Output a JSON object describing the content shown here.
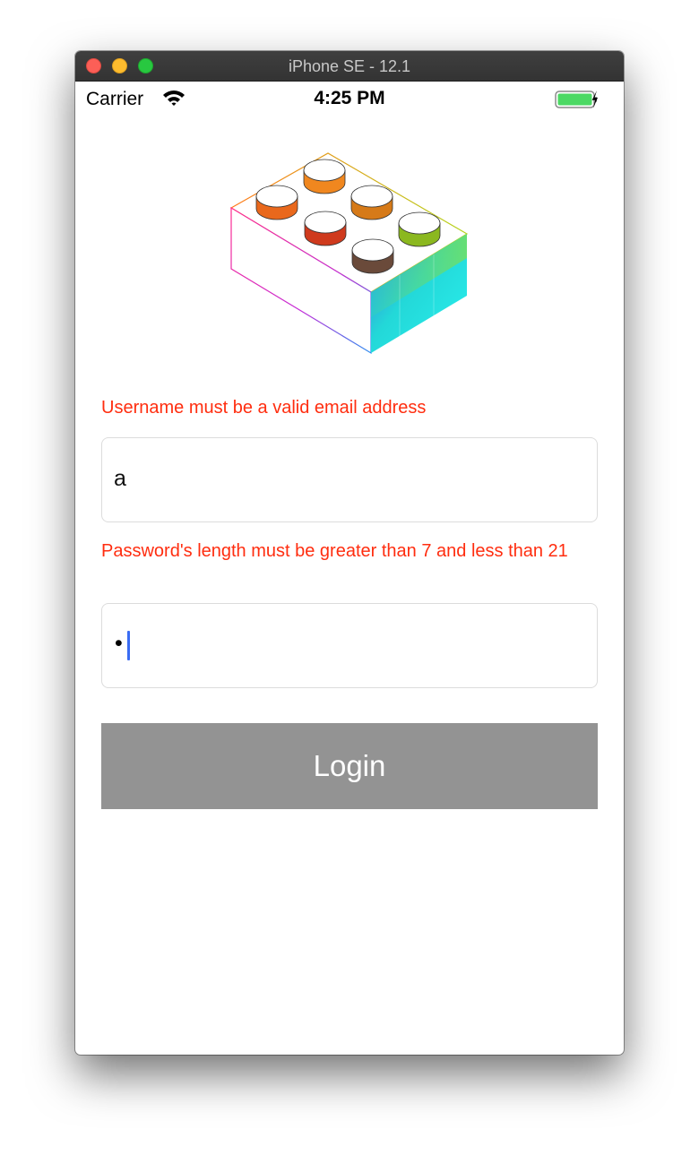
{
  "window": {
    "title": "iPhone SE - 12.1"
  },
  "status_bar": {
    "carrier": "Carrier",
    "time": "4:25 PM",
    "icons": [
      "wifi-icon",
      "battery-charging-icon"
    ]
  },
  "logo": {
    "icon": "lego-brick-icon"
  },
  "form": {
    "username_error": "Username must be a valid email address",
    "username_value": "a",
    "password_error": "Password's length must be greater than 7 and less than 21",
    "password_masked": "•",
    "login_label": "Login"
  },
  "colors": {
    "error": "#ff2d0f",
    "button_disabled": "#939393",
    "caret": "#3a6cf3",
    "battery": "#4cd964"
  }
}
